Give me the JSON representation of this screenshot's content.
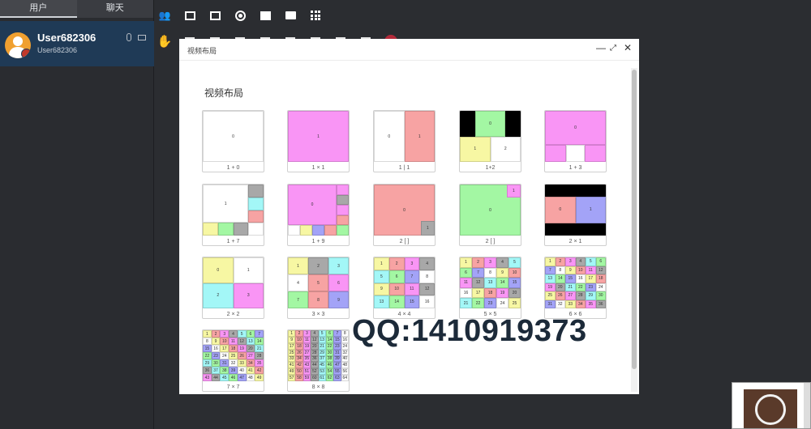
{
  "left_panel": {
    "tabs": [
      {
        "label": "用户",
        "active": true
      },
      {
        "label": "聊天",
        "active": false
      }
    ],
    "user": {
      "name": "User682306",
      "id": "User682306"
    }
  },
  "toolbar1": [
    "people-icon",
    "layout-film-icon",
    "layout-grid-icon",
    "record-icon",
    "whiteboard-icon",
    "folder-icon",
    "apps-grid-icon"
  ],
  "toolbar2": [
    "hand-icon",
    "mic-tool-icon",
    "camera-tool-icon",
    "fullscreen-icon",
    "screen-icon",
    "search-tool-icon",
    "doc-icon",
    "layers-icon",
    "list-icon",
    "stop-icon"
  ],
  "dialog": {
    "title": "视频布局",
    "section_title": "视频布局",
    "min_label": "—",
    "max_label": "⤢",
    "close_label": "✕"
  },
  "layouts": [
    {
      "label": "1 + 0"
    },
    {
      "label": "1 × 1"
    },
    {
      "label": "1 | 1"
    },
    {
      "label": "1+2"
    },
    {
      "label": "1 + 3"
    },
    {
      "label": "1 + 7"
    },
    {
      "label": "1 + 9"
    },
    {
      "label": "2 [ ]"
    },
    {
      "label": "2 [ ]"
    },
    {
      "label": "2 × 1"
    },
    {
      "label": "2 × 2"
    },
    {
      "label": "3 × 3"
    },
    {
      "label": "4 × 4"
    },
    {
      "label": "5 × 5"
    },
    {
      "label": "6 × 6"
    },
    {
      "label": "7 × 7"
    },
    {
      "label": "8 × 8"
    }
  ],
  "watermark": "QQ:1410919373",
  "colors": {
    "pink": "#f995f5",
    "salmon": "#f7a3a3",
    "green": "#a3f7a3",
    "yellow": "#f7f7a3",
    "blue": "#a3a3f7",
    "cyan": "#a3f7f7",
    "gray": "#a8a8a8",
    "black": "#000000",
    "white": "#ffffff"
  }
}
